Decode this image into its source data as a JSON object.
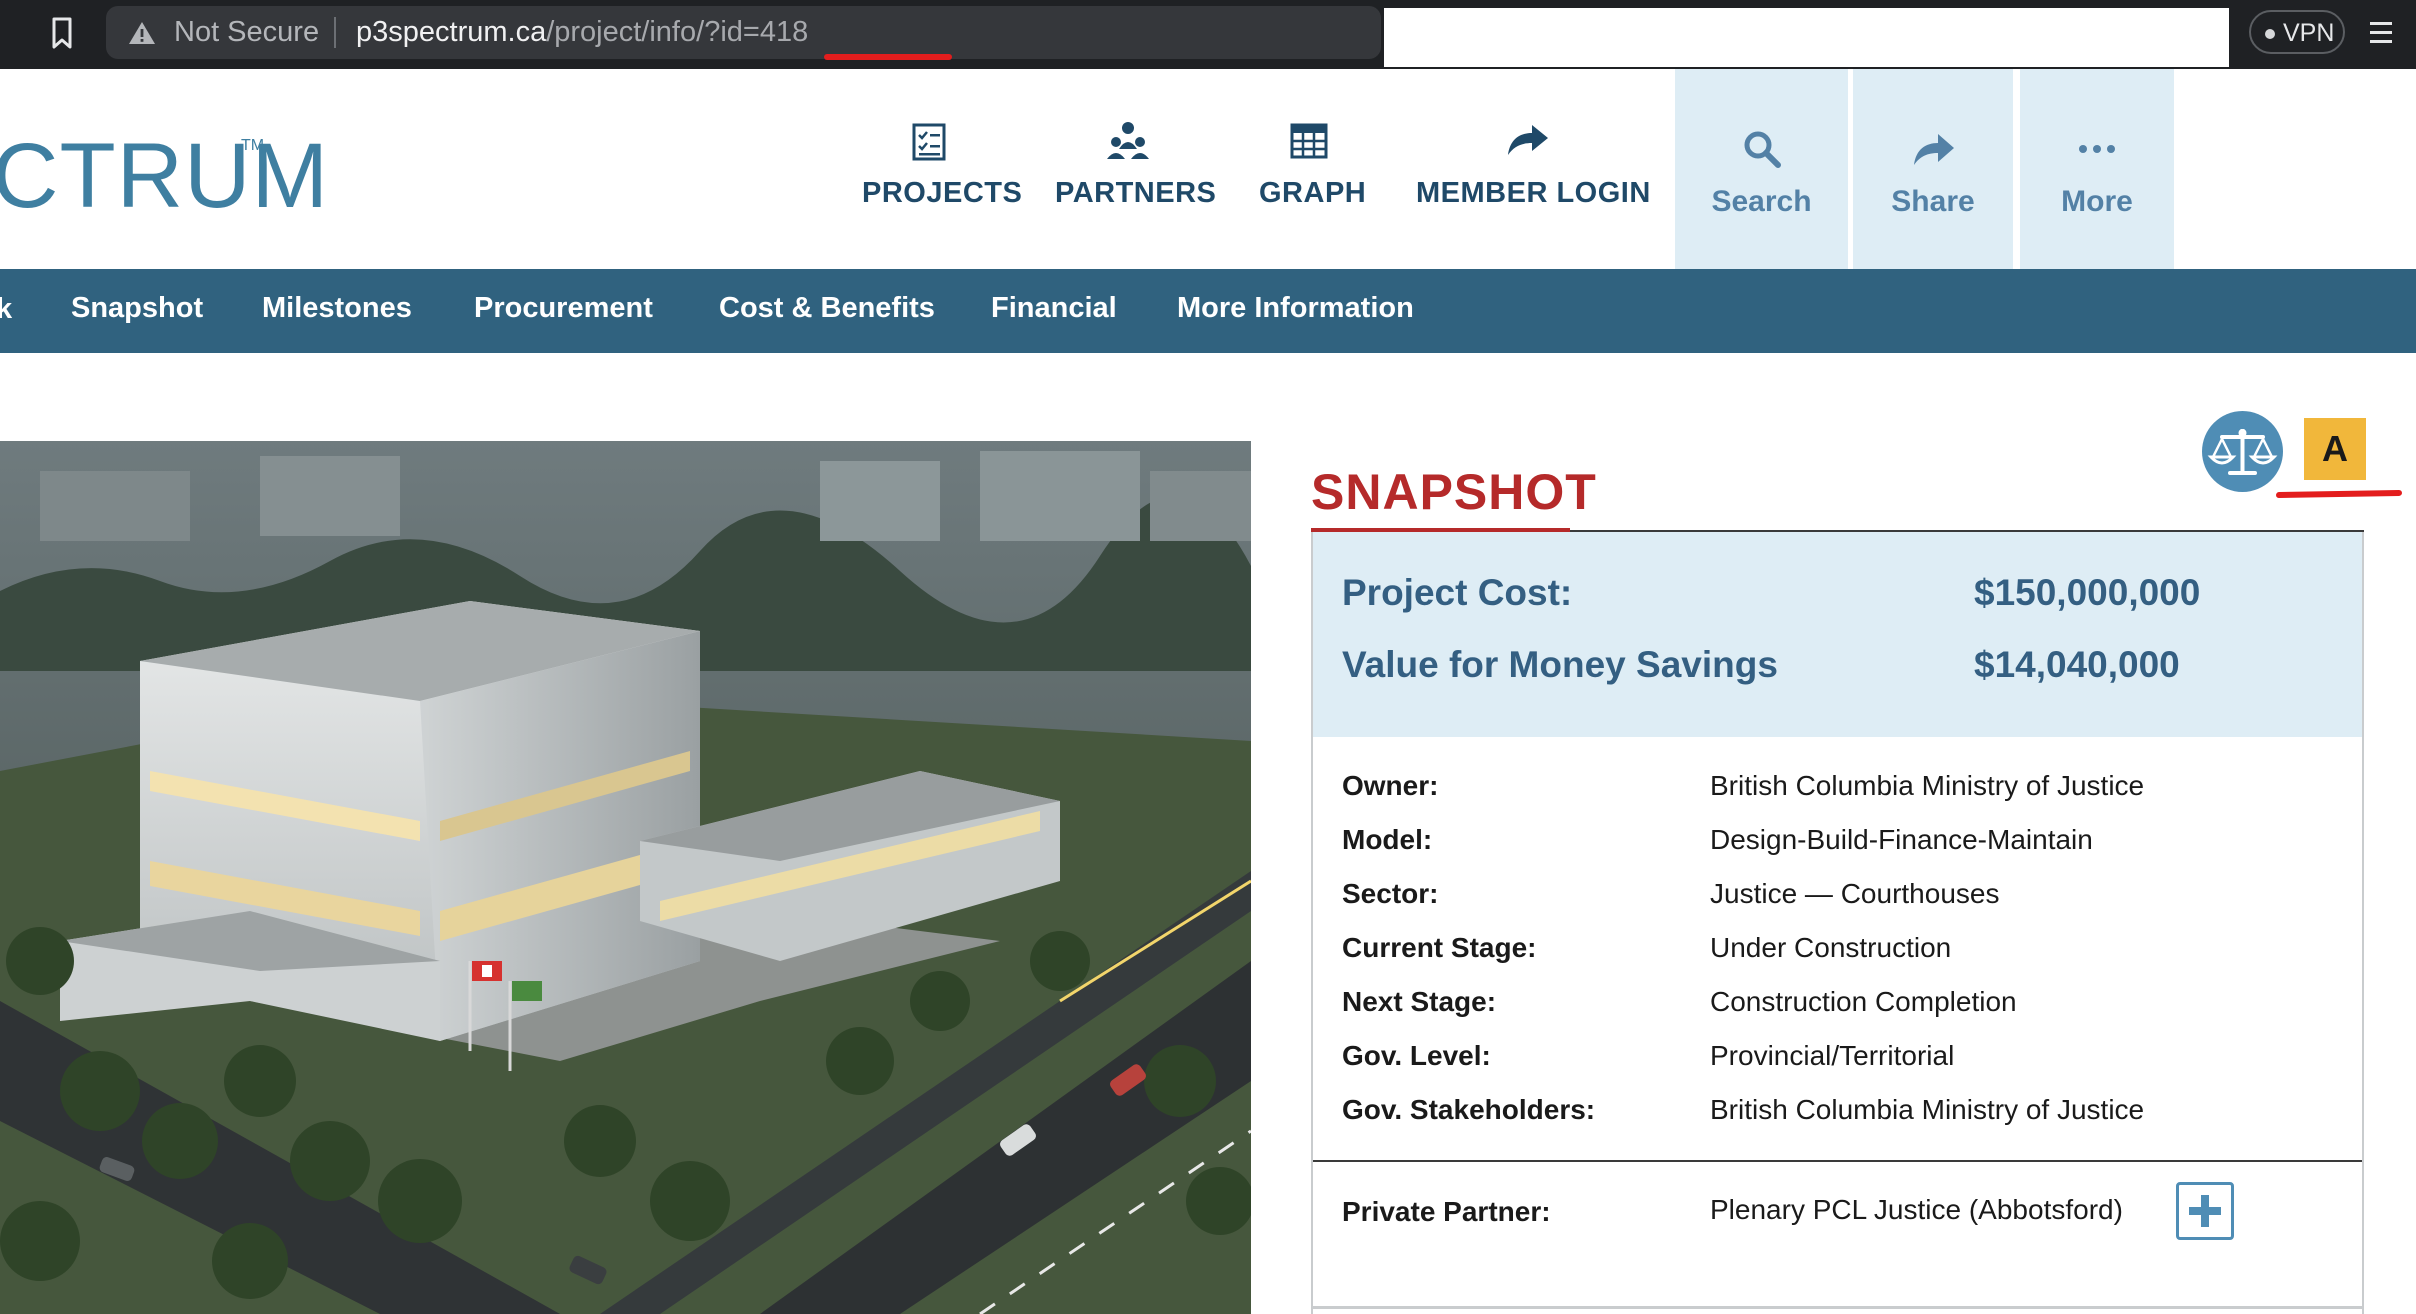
{
  "browser": {
    "security_label": "Not Secure",
    "url_host": "p3spectrum.ca",
    "url_path": "/project/info/",
    "url_query": "?id=418",
    "vpn_label": "VPN"
  },
  "site": {
    "logo_text": "CTRUM",
    "logo_tm": "TM",
    "nav": [
      {
        "label": "PROJECTS",
        "icon": "projects-list-icon"
      },
      {
        "label": "PARTNERS",
        "icon": "partners-people-icon"
      },
      {
        "label": "GRAPH",
        "icon": "grid-table-icon"
      },
      {
        "label": "MEMBER LOGIN",
        "icon": "share-arrow-icon"
      }
    ],
    "actions": [
      {
        "label": "Search",
        "icon": "search-icon"
      },
      {
        "label": "Share",
        "icon": "share-arrow-icon"
      },
      {
        "label": "More",
        "icon": "ellipsis-icon"
      }
    ]
  },
  "section_nav": {
    "fragment": "k",
    "links": [
      "Snapshot",
      "Milestones",
      "Procurement",
      "Cost & Benefits",
      "Financial",
      "More Information"
    ]
  },
  "snapshot": {
    "title": "SNAPSHOT",
    "grade": "A",
    "project_cost_label": "Project Cost:",
    "project_cost_value": "$150,000,000",
    "vfm_label": "Value for Money Savings",
    "vfm_value": "$14,040,000",
    "details": [
      {
        "label": "Owner:",
        "value": "British Columbia Ministry of Justice"
      },
      {
        "label": "Model:",
        "value": "Design-Build-Finance-Maintain"
      },
      {
        "label": "Sector:",
        "value": "Justice — Courthouses"
      },
      {
        "label": "Current Stage:",
        "value": "Under Construction"
      },
      {
        "label": "Next Stage:",
        "value": "Construction Completion"
      },
      {
        "label": "Gov. Level:",
        "value": "Provincial/Territorial"
      },
      {
        "label": "Gov. Stakeholders:",
        "value": "British Columbia Ministry of Justice"
      }
    ],
    "private_partner_label": "Private Partner:",
    "private_partner_value": "Plenary PCL Justice (Abbotsford)"
  },
  "colors": {
    "brand_blue": "#30627f",
    "nav_text": "#1f4968",
    "snapshot_red": "#b52a2a",
    "grade_yellow": "#f1b73b",
    "annotation_red": "#e31d1d"
  }
}
